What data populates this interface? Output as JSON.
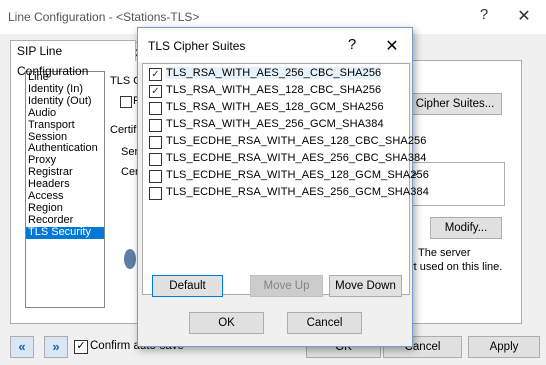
{
  "main_window": {
    "title": "Line Configuration - <Stations-TLS>",
    "help_glyph": "?",
    "close_glyph": "✕",
    "tabs": [
      {
        "label": "SIP Line Configuration"
      },
      {
        "label": "C"
      }
    ],
    "categories": [
      {
        "label": "Line"
      },
      {
        "label": "Identity (In)"
      },
      {
        "label": "Identity (Out)"
      },
      {
        "label": "Audio"
      },
      {
        "label": "Transport"
      },
      {
        "label": "Session"
      },
      {
        "label": "Authentication"
      },
      {
        "label": "Proxy"
      },
      {
        "label": "Registrar"
      },
      {
        "label": "Headers"
      },
      {
        "label": "Access"
      },
      {
        "label": "Region"
      },
      {
        "label": "Recorder"
      },
      {
        "label": "TLS Security",
        "selected": true
      }
    ],
    "partial_labels": {
      "tls_header": "TLS O",
      "checkbox_r": "R",
      "certif": "Certif",
      "serv": "Serv",
      "cert": "Cert",
      "gt": ">",
      "server_line1": "The server",
      "server_line2": "rt used on this line."
    },
    "cipher_suites_button": "Cipher Suites...",
    "modify_button": "Modify...",
    "nav_prev": "«",
    "nav_next": "»",
    "confirm_autosave": {
      "label": "Confirm auto-save",
      "checked": true
    },
    "ok_button": "OK",
    "cancel_button": "Cancel",
    "apply_button": "Apply"
  },
  "dialog": {
    "title": "TLS Cipher Suites",
    "help_glyph": "?",
    "close_glyph": "✕",
    "ciphers": [
      {
        "label": "TLS_RSA_WITH_AES_256_CBC_SHA256",
        "checked": true
      },
      {
        "label": "TLS_RSA_WITH_AES_128_CBC_SHA256",
        "checked": true
      },
      {
        "label": "TLS_RSA_WITH_AES_128_GCM_SHA256",
        "checked": false
      },
      {
        "label": "TLS_RSA_WITH_AES_256_GCM_SHA384",
        "checked": false
      },
      {
        "label": "TLS_ECDHE_RSA_WITH_AES_128_CBC_SHA256",
        "checked": false
      },
      {
        "label": "TLS_ECDHE_RSA_WITH_AES_256_CBC_SHA384",
        "checked": false
      },
      {
        "label": "TLS_ECDHE_RSA_WITH_AES_128_GCM_SHA256",
        "checked": false
      },
      {
        "label": "TLS_ECDHE_RSA_WITH_AES_256_GCM_SHA384",
        "checked": false
      }
    ],
    "default_button": "Default",
    "move_up_button": "Move Up",
    "move_down_button": "Move Down",
    "ok_button": "OK",
    "cancel_button": "Cancel"
  },
  "colors": {
    "selection": "#0078d7",
    "window_bg": "#f0f0f0"
  }
}
